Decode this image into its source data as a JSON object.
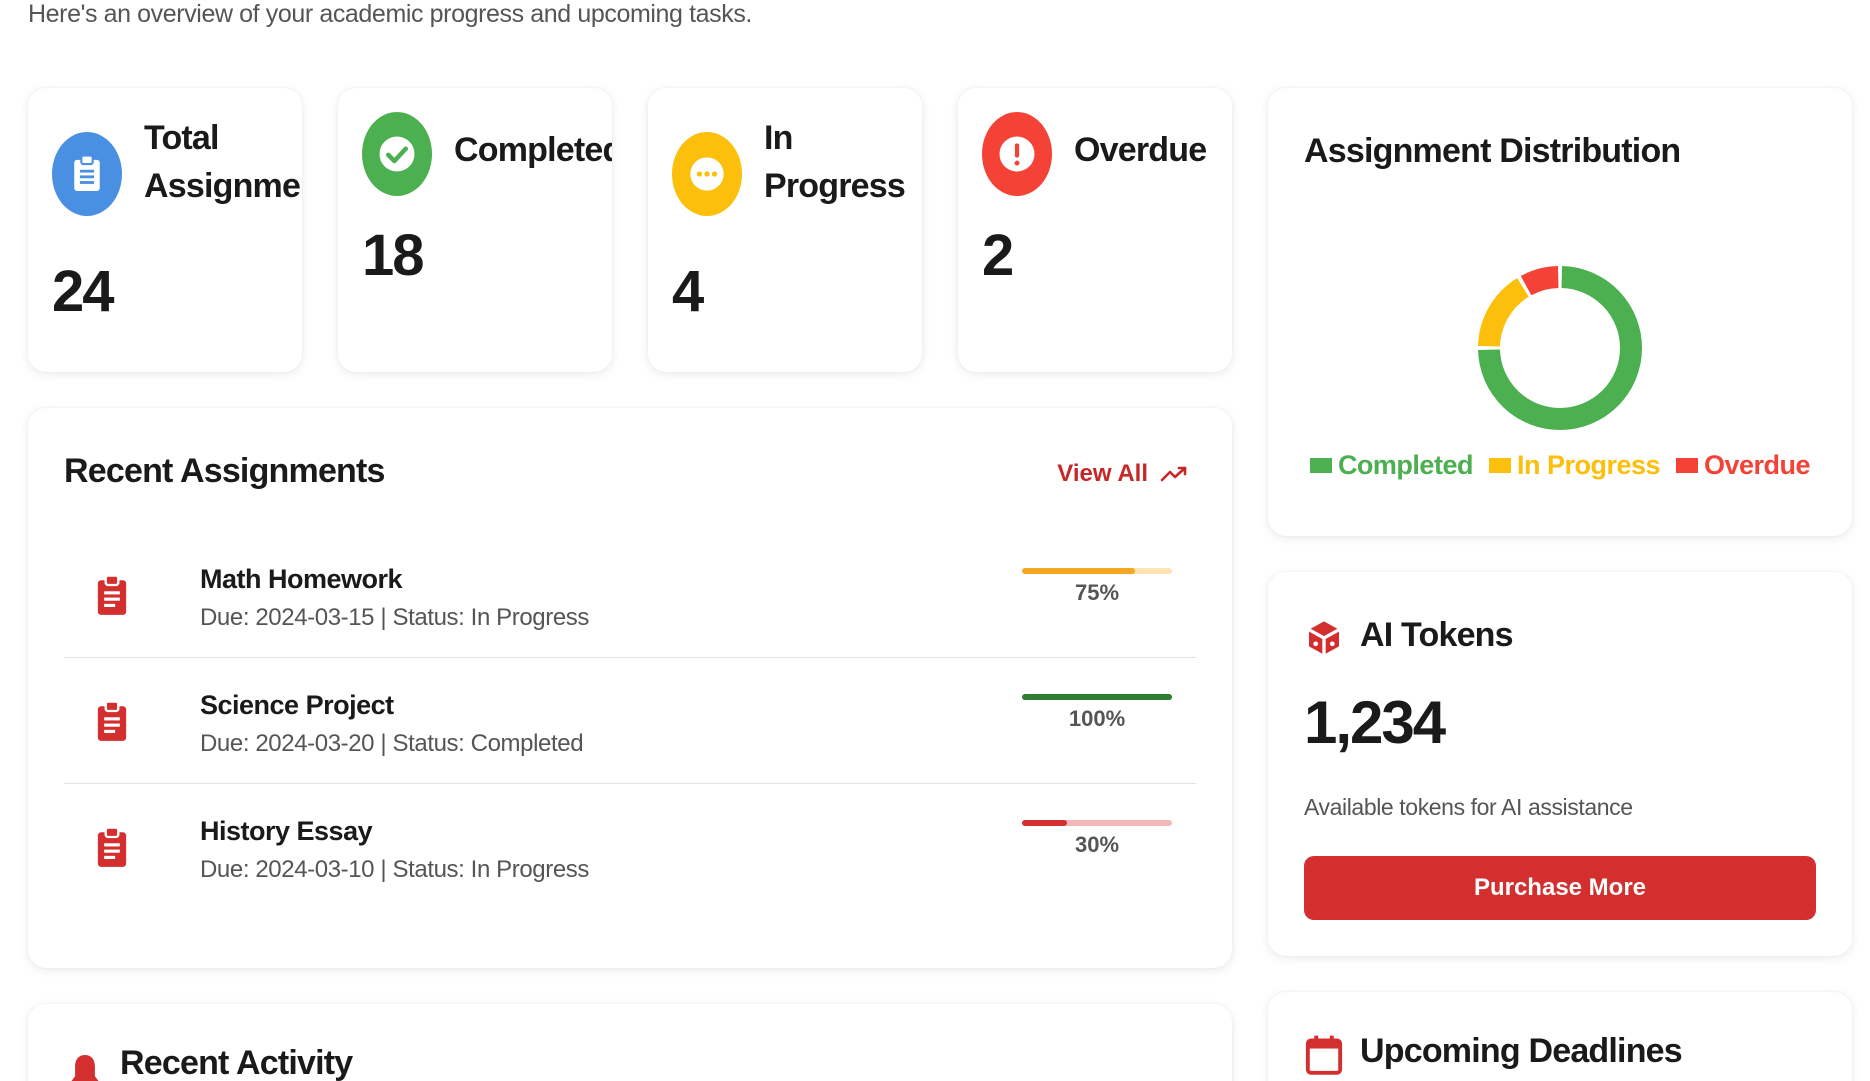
{
  "subtitle": "Here's an overview of your academic progress and upcoming tasks.",
  "stats": [
    {
      "label": "Total Assignments",
      "value": "24",
      "icon": "clipboard-icon",
      "color": "#4a90e2"
    },
    {
      "label": "Completed",
      "value": "18",
      "icon": "check-circle-icon",
      "color": "#4caf50"
    },
    {
      "label": "In Progress",
      "value": "4",
      "icon": "more-horizontal-icon",
      "color": "#fbbf0c"
    },
    {
      "label": "Overdue",
      "value": "2",
      "icon": "alert-icon",
      "color": "#f44336"
    }
  ],
  "recent_assignments": {
    "title": "Recent Assignments",
    "view_all": "View All",
    "items": [
      {
        "name": "Math Homework",
        "meta": "Due: 2024-03-15 | Status: In Progress",
        "progress": 75,
        "progress_label": "75%",
        "bar_color": "#f5a623",
        "track_color": "#fde2b3"
      },
      {
        "name": "Science Project",
        "meta": "Due: 2024-03-20 | Status: Completed",
        "progress": 100,
        "progress_label": "100%",
        "bar_color": "#2e7d32",
        "track_color": "#c8e6c9"
      },
      {
        "name": "History Essay",
        "meta": "Due: 2024-03-10 | Status: In Progress",
        "progress": 30,
        "progress_label": "30%",
        "bar_color": "#d32f2f",
        "track_color": "#f2b8b8"
      }
    ]
  },
  "recent_activity": {
    "title": "Recent Activity"
  },
  "distribution": {
    "title": "Assignment Distribution",
    "legend": [
      {
        "label": "Completed",
        "color": "#4caf50"
      },
      {
        "label": "In Progress",
        "color": "#fbbf0c"
      },
      {
        "label": "Overdue",
        "color": "#f44336"
      }
    ]
  },
  "chart_data": {
    "type": "pie",
    "title": "Assignment Distribution",
    "categories": [
      "Completed",
      "In Progress",
      "Overdue"
    ],
    "values": [
      18,
      4,
      2
    ],
    "colors": [
      "#4caf50",
      "#fbbf0c",
      "#f44336"
    ],
    "legend": "bottom"
  },
  "ai_tokens": {
    "title": "AI Tokens",
    "value": "1,234",
    "caption": "Available tokens for AI assistance",
    "button": "Purchase More"
  },
  "upcoming_deadlines": {
    "title": "Upcoming Deadlines"
  }
}
